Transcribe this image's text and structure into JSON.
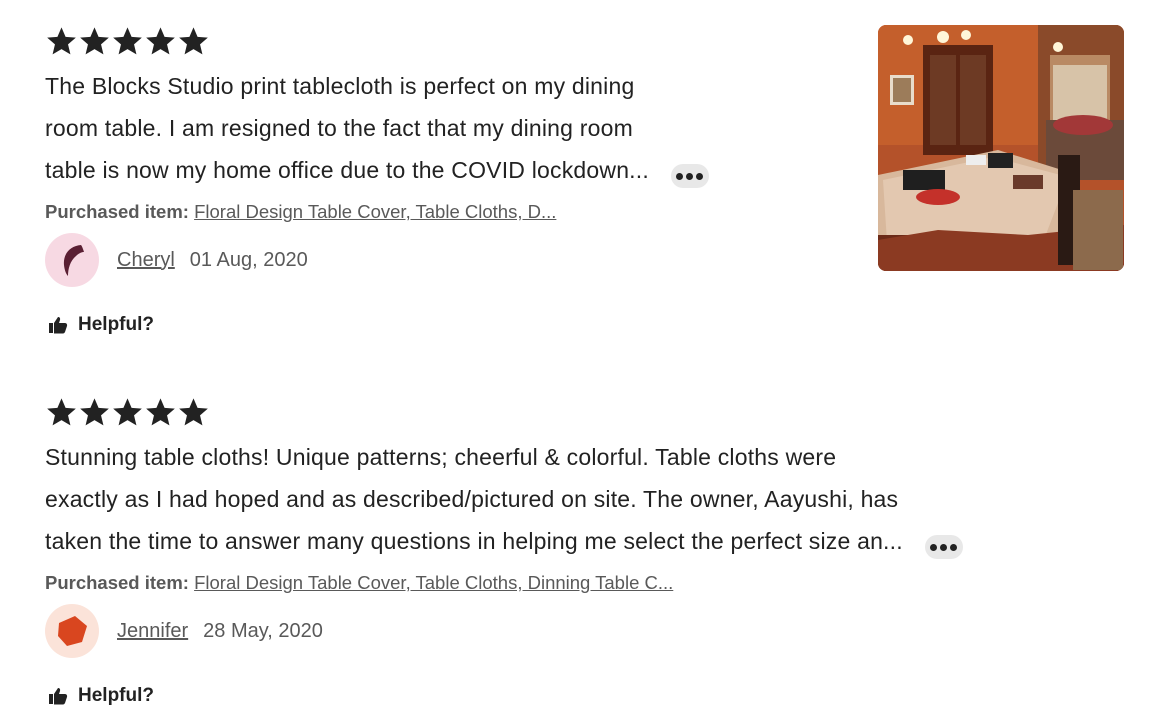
{
  "reviews": [
    {
      "rating": 5,
      "text": "The Blocks Studio print tablecloth is perfect on my dining room table. I am resigned to the fact that my dining room table is now my home office due to the COVID lockdown...",
      "text_lines": [
        "The Blocks Studio print tablecloth is perfect on my dining",
        "room table. I am resigned to the fact that my dining room",
        "table is now my home office due to the COVID lockdown..."
      ],
      "purchased_label": "Purchased item:",
      "purchased_item": "Floral Design Table Cover, Table Cloths, D...",
      "reviewer_name": "Cheryl",
      "date": "01 Aug, 2020",
      "helpful_label": "Helpful?",
      "avatar_color": "#f7d9e3",
      "avatar_icon": "crescent-shape-icon",
      "has_photo": true
    },
    {
      "rating": 5,
      "text_lines": [
        "Stunning table cloths! Unique patterns; cheerful & colorful. Table cloths were",
        "exactly as I had hoped and as described/pictured on site. The owner, Aayushi, has",
        "taken the time to answer many questions in helping me select the perfect size an..."
      ],
      "purchased_label": "Purchased item:",
      "purchased_item": "Floral Design Table Cover, Table Cloths, Dinning Table C...",
      "reviewer_name": "Jennifer",
      "date": "28 May, 2020",
      "helpful_label": "Helpful?",
      "avatar_color": "#fbe3d9",
      "avatar_icon": "pentagon-shape-icon",
      "has_photo": false
    }
  ],
  "colors": {
    "text": "#222222",
    "muted": "#595959",
    "star": "#222222",
    "more_button_bg": "#e8e8e8"
  }
}
